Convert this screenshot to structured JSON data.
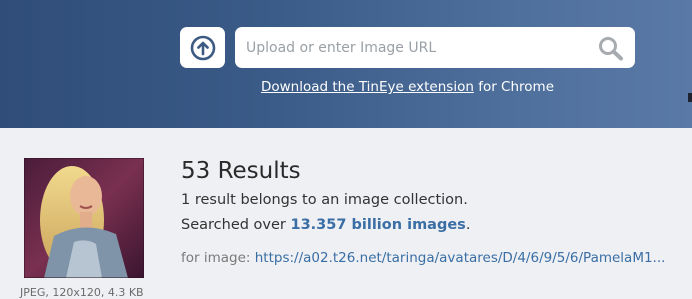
{
  "header": {
    "upload_icon": "upload-arrow-icon",
    "search": {
      "placeholder": "Upload or enter Image URL",
      "value": "",
      "icon": "search-icon"
    },
    "extension_link": "Download the TinEye extension",
    "extension_suffix": " for Chrome"
  },
  "results": {
    "count_title": "53 Results",
    "collection_text": "1 result belongs to an image collection.",
    "searched_prefix": "Searched over ",
    "searched_count": "13.357 billion images",
    "searched_suffix": ".",
    "for_image_label": "for image: ",
    "for_image_url": "https://a02.t26.net/taringa/avatares/D/4/6/9/5/6/PamelaM1..."
  },
  "query_image": {
    "meta": "JPEG, 120x120, 4.3 KB"
  },
  "colors": {
    "header_bg": "#3b5b88",
    "accent_link": "#3a6ea5",
    "page_bg": "#eef0f3"
  }
}
